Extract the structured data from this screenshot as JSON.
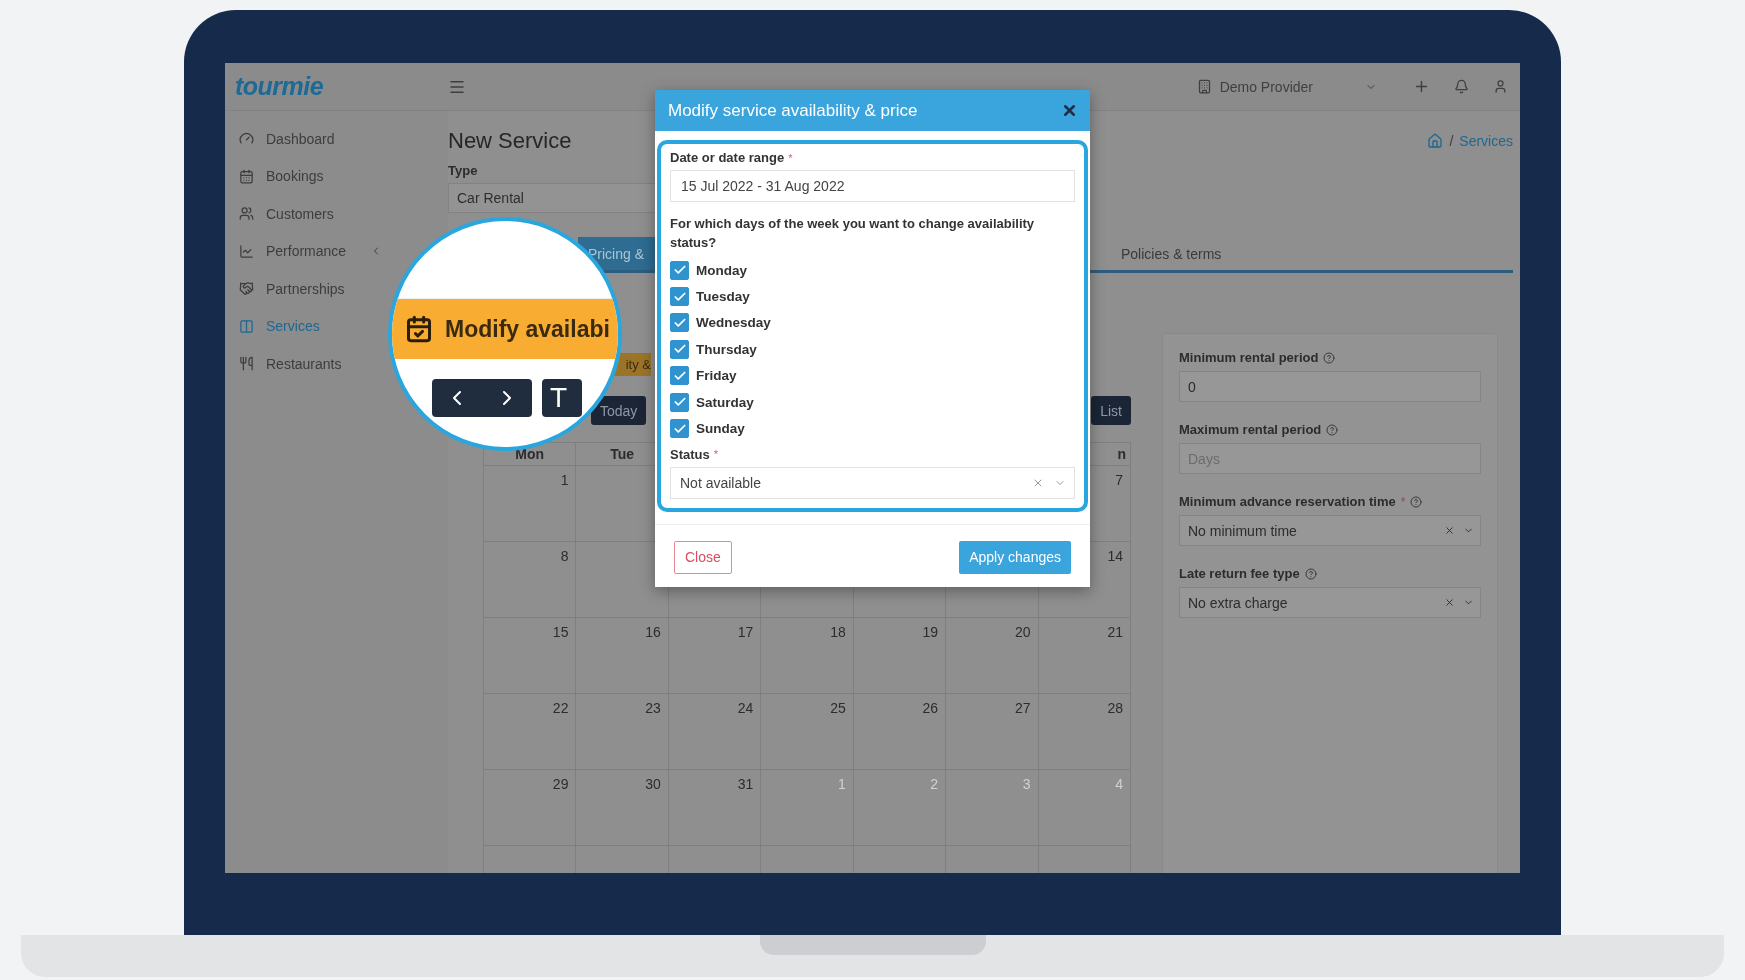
{
  "app": {
    "logo": "tourmie",
    "provider": "Demo Provider"
  },
  "sidebar": {
    "items": [
      {
        "label": "Dashboard",
        "selected": false
      },
      {
        "label": "Bookings",
        "selected": false
      },
      {
        "label": "Customers",
        "selected": false
      },
      {
        "label": "Performance",
        "selected": false
      },
      {
        "label": "Partnerships",
        "selected": false
      },
      {
        "label": "Services",
        "selected": true
      },
      {
        "label": "Restaurants",
        "selected": false
      }
    ]
  },
  "page": {
    "title": "New Service",
    "breadcrumb": {
      "separator": "/",
      "current": "Services"
    }
  },
  "type_field": {
    "label": "Type",
    "value": "Car Rental"
  },
  "tabs": [
    {
      "label": "Pricing &",
      "selected": true
    },
    {
      "label": "Policies & terms",
      "selected": false
    }
  ],
  "subtab": {
    "label": "ity &"
  },
  "calendar": {
    "today": "Today",
    "list": "List",
    "weekdays": [
      "Mon",
      "Tue",
      "n"
    ],
    "weeks": [
      [
        {
          "day": "1",
          "other_month": false
        },
        {
          "day": "7",
          "other_month": false
        }
      ],
      [
        {
          "day": "8",
          "other_month": false
        },
        {
          "day": "14",
          "other_month": false
        }
      ],
      [
        {
          "day": "15",
          "other_month": false
        },
        {
          "day": "16",
          "other_month": false
        },
        {
          "day": "17",
          "other_month": false
        },
        {
          "day": "18",
          "other_month": false
        },
        {
          "day": "19",
          "other_month": false
        },
        {
          "day": "20",
          "other_month": false
        },
        {
          "day": "21",
          "other_month": false
        }
      ],
      [
        {
          "day": "22",
          "other_month": false
        },
        {
          "day": "23",
          "other_month": false
        },
        {
          "day": "24",
          "other_month": false
        },
        {
          "day": "25",
          "other_month": false
        },
        {
          "day": "26",
          "other_month": false
        },
        {
          "day": "27",
          "other_month": false
        },
        {
          "day": "28",
          "other_month": false
        }
      ],
      [
        {
          "day": "29",
          "other_month": false
        },
        {
          "day": "30",
          "other_month": false
        },
        {
          "day": "31",
          "other_month": false
        },
        {
          "day": "1",
          "other_month": true
        },
        {
          "day": "2",
          "other_month": true
        },
        {
          "day": "3",
          "other_month": true
        },
        {
          "day": "4",
          "other_month": true
        }
      ]
    ]
  },
  "settings": [
    {
      "kind": "input",
      "label": "Minimum rental period",
      "value": "0"
    },
    {
      "kind": "input",
      "label": "Maximum rental period",
      "placeholder": "Days"
    },
    {
      "kind": "select",
      "label": "Minimum advance reservation time",
      "required_mark": "*",
      "value": "No minimum time"
    },
    {
      "kind": "select",
      "label": "Late return fee type",
      "value": "No extra charge"
    }
  ],
  "modal": {
    "title": "Modify service availability & price",
    "date_label": "Date or date range",
    "date_required_mark": "*",
    "date_value": "15 Jul 2022 - 31 Aug 2022",
    "question": "For which days of the week you want to change availability status?",
    "days": [
      {
        "label": "Monday",
        "checked": true
      },
      {
        "label": "Tuesday",
        "checked": true
      },
      {
        "label": "Wednesday",
        "checked": true
      },
      {
        "label": "Thursday",
        "checked": true
      },
      {
        "label": "Friday",
        "checked": true
      },
      {
        "label": "Saturday",
        "checked": true
      },
      {
        "label": "Sunday",
        "checked": true
      }
    ],
    "status_label": "Status",
    "status_required_mark": "*",
    "status_value": "Not available",
    "close_button": "Close",
    "apply_button": "Apply changes"
  },
  "magnifier": {
    "banner": "Modify availabi",
    "button_fragment": "T"
  }
}
